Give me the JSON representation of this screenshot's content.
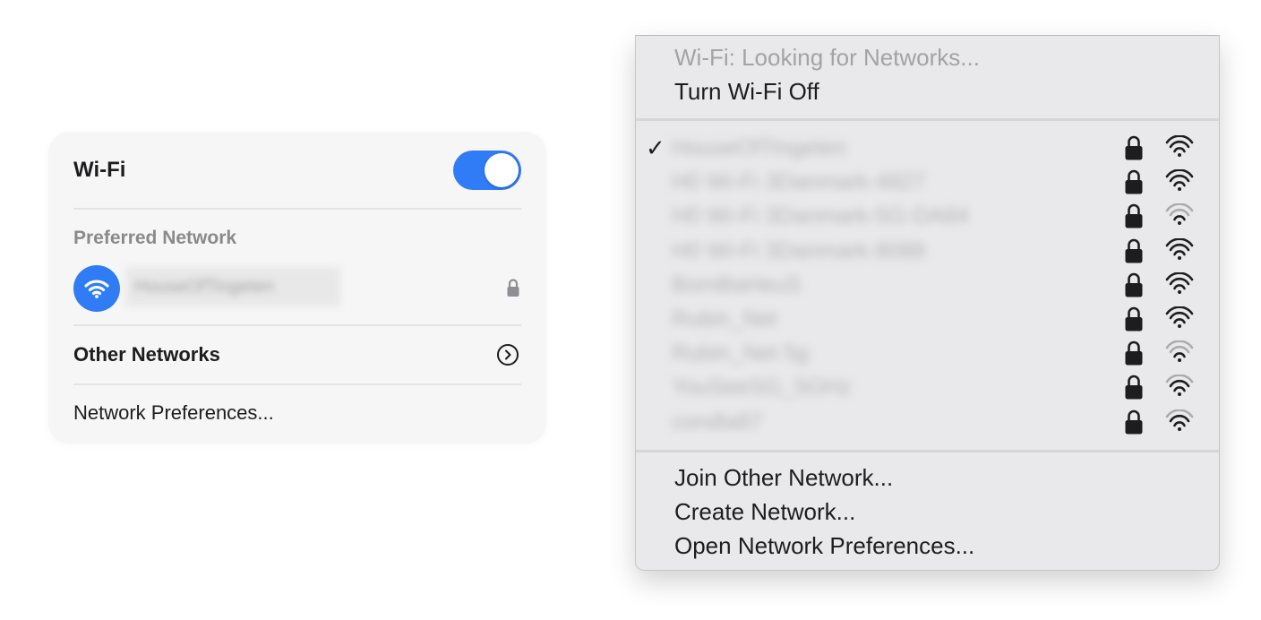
{
  "control_center": {
    "title": "Wi-Fi",
    "toggle_on": true,
    "preferred_label": "Preferred Network",
    "preferred_network": "HouseOfTingeten",
    "other_networks": "Other Networks",
    "network_preferences": "Network Preferences..."
  },
  "menu": {
    "status": "Wi-Fi: Looking for Networks...",
    "turn_off": "Turn Wi-Fi Off",
    "networks": [
      {
        "name": "HouseOfTingeten",
        "checked": true,
        "locked": true,
        "signal": "strong"
      },
      {
        "name": "H0 Wi-Fi 3Danmark-4827",
        "checked": false,
        "locked": true,
        "signal": "strong"
      },
      {
        "name": "H0 Wi-Fi 3Danmark-5G-DA84",
        "checked": false,
        "locked": true,
        "signal": "weak"
      },
      {
        "name": "H0 Wi-Fi 3Danmark-8088",
        "checked": false,
        "locked": true,
        "signal": "strong"
      },
      {
        "name": "BomBaHeuS",
        "checked": false,
        "locked": true,
        "signal": "strong"
      },
      {
        "name": "Rubin_Net",
        "checked": false,
        "locked": true,
        "signal": "strong"
      },
      {
        "name": "Rubin_Net 5g",
        "checked": false,
        "locked": true,
        "signal": "weak"
      },
      {
        "name": "YouSeeSG_5GHz",
        "checked": false,
        "locked": true,
        "signal": "medium"
      },
      {
        "name": "condla87",
        "checked": false,
        "locked": true,
        "signal": "medium"
      }
    ],
    "join_other": "Join Other Network...",
    "create_network": "Create Network...",
    "open_prefs": "Open Network Preferences..."
  },
  "colors": {
    "accent": "#2f7cf6",
    "menu_bg": "#e9e9eb",
    "panel_bg": "#f6f6f6"
  },
  "icons": [
    "wifi-icon",
    "lock-icon",
    "chevron-right-circle-icon",
    "checkmark-icon"
  ]
}
